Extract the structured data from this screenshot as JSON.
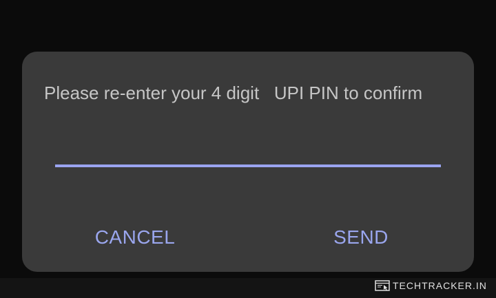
{
  "dialog": {
    "message": "Please re-enter your 4 digit   UPI PIN to confirm",
    "pin_value": "",
    "pin_placeholder": "",
    "cancel_label": "CANCEL",
    "send_label": "SEND"
  },
  "watermark": {
    "text": "TECHTRACKER.IN",
    "icon": "browser-cursor-icon"
  },
  "colors": {
    "background": "#0b0b0b",
    "dialog": "#3a3a3a",
    "message_text": "#c6c6c6",
    "accent": "#9aa6ee",
    "underline": "#9aa4f0"
  }
}
